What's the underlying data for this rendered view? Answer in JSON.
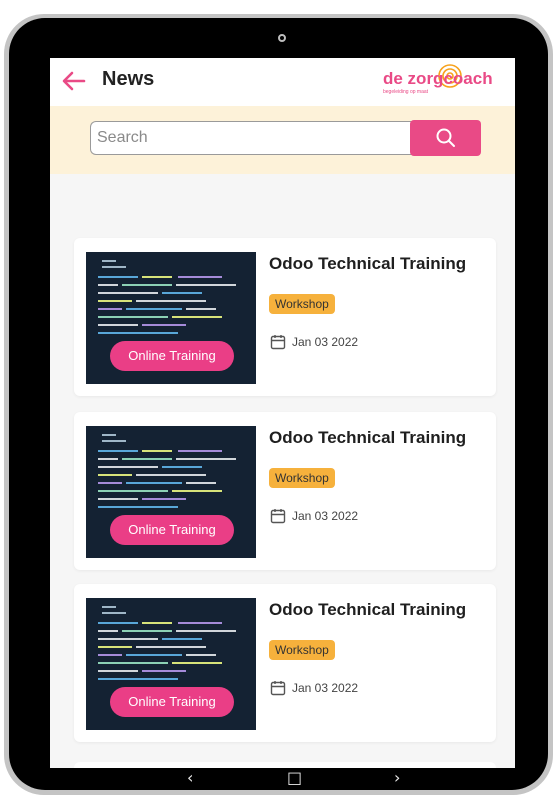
{
  "header": {
    "title": "News",
    "back_icon": "arrow-left-icon",
    "logo_text": "de zorgcoach",
    "logo_tagline": "begeleiding op maat"
  },
  "search": {
    "placeholder": "Search",
    "value": "",
    "button_icon": "search-icon"
  },
  "cards": [
    {
      "title": "Odoo Technical  Training",
      "category": "Workshop",
      "date": "Jan 03 2022",
      "badge": "Online Training"
    },
    {
      "title": "Odoo Technical  Training",
      "category": "Workshop",
      "date": "Jan 03 2022",
      "badge": "Online Training"
    },
    {
      "title": "Odoo Technical  Training",
      "category": "Workshop",
      "date": "Jan 03 2022",
      "badge": "Online Training"
    }
  ],
  "nav": {
    "back": "‹",
    "home": "□",
    "recents": "›"
  },
  "colors": {
    "accent": "#e94a86",
    "band": "#fdf2d9",
    "tag": "#f6b13c",
    "logo_orange": "#f7a11a"
  }
}
